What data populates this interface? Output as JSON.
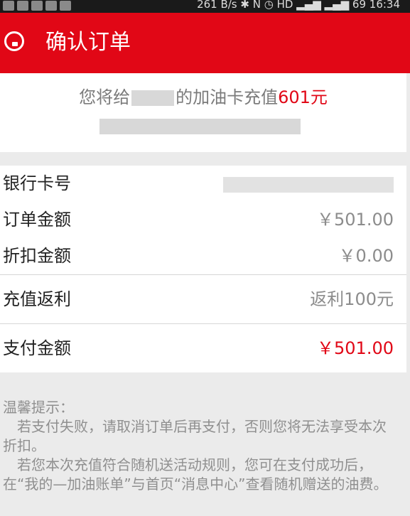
{
  "status_bar": {
    "right_text": "261 B/s ✱ N ◷ HD ▂▄▆ ▂▄▆ 69 16:34"
  },
  "header": {
    "title": "确认订单"
  },
  "summary": {
    "prefix": "您将给",
    "middle": "的加油卡充值",
    "amount": "601元"
  },
  "details": {
    "bank_card_label": "银行卡号",
    "order_amount_label": "订单金额",
    "order_amount_value": "￥501.00",
    "discount_label": "折扣金额",
    "discount_value": "￥0.00",
    "rebate_label": "充值返利",
    "rebate_value": "返利100元",
    "pay_label": "支付金额",
    "pay_value": "￥501.00"
  },
  "tips": {
    "title": "温馨提示：",
    "line1": "若支付失败，请取消订单后再支付，否则您将无法享受本次折扣。",
    "line2": "若您本次充值符合随机送活动规则，您可在支付成功后，在“我的—加油账单”与首页“消息中心”查看随机赠送的油费。"
  },
  "colors": {
    "brand_red": "#e10716",
    "page_bg": "#ebebeb"
  }
}
